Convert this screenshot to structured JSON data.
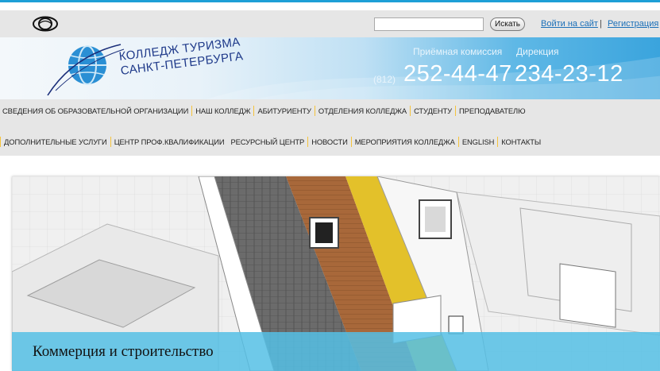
{
  "accessibility": {
    "icon": "eye-icon"
  },
  "search": {
    "placeholder": "",
    "button_label": "Искать"
  },
  "auth": {
    "login_label": "Войти на сайт",
    "separator": "|",
    "register_label": "Регистрация"
  },
  "logo": {
    "line1": "КОЛЛЕДЖ ТУРИЗМА",
    "line2": "САНКТ-ПЕТЕРБУРГА"
  },
  "contacts": {
    "label1": "Приёмная комиссия",
    "label2": "Дирекция",
    "code": "(812)",
    "phone1": "252-44-47",
    "phone2": "234-23-12"
  },
  "nav": {
    "row1": [
      "СВЕДЕНИЯ ОБ ОБРАЗОВАТЕЛЬНОЙ ОРГАНИЗАЦИИ",
      "НАШ КОЛЛЕДЖ",
      "АБИТУРИЕНТУ",
      "ОТДЕЛЕНИЯ КОЛЛЕДЖА",
      "СТУДЕНТУ",
      "ПРЕПОДАВАТЕЛЮ"
    ],
    "row2": [
      "ДОПОЛНИТЕЛЬНЫЕ УСЛУГИ",
      "ЦЕНТР ПРОФ.КВАЛИФИКАЦИИ",
      "РЕСУРСНЫЙ ЦЕНТР",
      "НОВОСТИ",
      "МЕРОПРИЯТИЯ КОЛЛЕДЖА",
      "ENGLISH",
      "КОНТАКТЫ"
    ]
  },
  "slider": {
    "caption": "Коммерция и строительство"
  },
  "colors": {
    "accent": "#1e9fd6",
    "nav_separator": "#f5c33b",
    "caption_bg": "#55c0e5",
    "link": "#1a6fb8"
  }
}
